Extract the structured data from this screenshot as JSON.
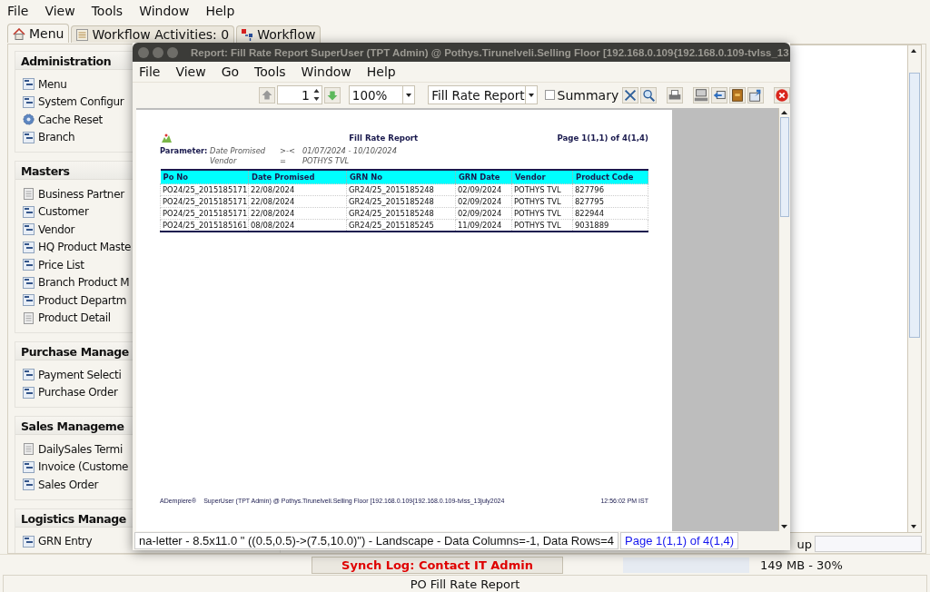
{
  "menubar": [
    "File",
    "View",
    "Tools",
    "Window",
    "Help"
  ],
  "tabs": [
    {
      "label": "Menu",
      "kind": "home",
      "selected": true
    },
    {
      "label": "Workflow Activities: 0",
      "kind": "list",
      "selected": false
    },
    {
      "label": "Workflow",
      "kind": "flow",
      "selected": false
    }
  ],
  "menu_groups": [
    {
      "title": "Administration",
      "items": [
        {
          "label": "Menu",
          "kind": "window"
        },
        {
          "label": "System Configur",
          "kind": "window"
        },
        {
          "label": "Cache Reset",
          "kind": "process"
        },
        {
          "label": "Branch",
          "kind": "window"
        }
      ]
    },
    {
      "title": "Masters",
      "items": [
        {
          "label": "Business Partner",
          "kind": "form"
        },
        {
          "label": "Customer",
          "kind": "window"
        },
        {
          "label": "Vendor",
          "kind": "window"
        },
        {
          "label": "HQ Product Maste",
          "kind": "window"
        },
        {
          "label": "Price List",
          "kind": "window"
        },
        {
          "label": "Branch Product M",
          "kind": "window"
        },
        {
          "label": "Product Departm",
          "kind": "window"
        },
        {
          "label": "Product Detail",
          "kind": "form"
        }
      ]
    },
    {
      "title": "Purchase Manage",
      "items": [
        {
          "label": "Payment Selecti",
          "kind": "window"
        },
        {
          "label": "Purchase Order",
          "kind": "window"
        }
      ]
    },
    {
      "title": "Sales Manageme",
      "items": [
        {
          "label": "DailySales Termi",
          "kind": "form"
        },
        {
          "label": "Invoice (Custome",
          "kind": "window"
        },
        {
          "label": "Sales Order",
          "kind": "window"
        }
      ]
    },
    {
      "title": "Logistics Manage",
      "items": [
        {
          "label": "GRN Entry",
          "kind": "window"
        }
      ]
    }
  ],
  "find_label": "up",
  "status_bar": {
    "sync_log": "Synch Log: Contact IT Admin",
    "memory": "149 MB - 30%"
  },
  "footer_title": "PO Fill Rate Report",
  "report_window": {
    "title": "Report: Fill Rate Report  SuperUser (TPT Admin) @ Pothys.Tirunelveli.Selling Floor [192.168.0.109{192.168.0.109-tvlss_13",
    "menu": [
      "File",
      "View",
      "Go",
      "Tools",
      "Window",
      "Help"
    ],
    "toolbar": {
      "page": "1",
      "zoom": "100%",
      "report": "Fill Rate Report",
      "summary": {
        "label": "Summary",
        "checked": false
      }
    },
    "page": {
      "title": "Fill Rate Report",
      "page_info": "Page 1(1,1) of 4(1,4)",
      "parameter_label": "Parameter:",
      "parameters": [
        {
          "name": "Date Promised",
          "operator": ">-<",
          "value": "01/07/2024 - 10/10/2024"
        },
        {
          "name": "Vendor",
          "operator": "=",
          "value": "POTHYS TVL"
        }
      ],
      "table": {
        "columns": [
          "Po No",
          "Date Promised",
          "GRN No",
          "GRN Date",
          "Vendor",
          "Product Code"
        ],
        "rows": [
          [
            "PO24/25_2015185171",
            "22/08/2024",
            "GR24/25_2015185248",
            "02/09/2024",
            "POTHYS TVL",
            "827796"
          ],
          [
            "PO24/25_2015185171",
            "22/08/2024",
            "GR24/25_2015185248",
            "02/09/2024",
            "POTHYS TVL",
            "827795"
          ],
          [
            "PO24/25_2015185171",
            "22/08/2024",
            "GR24/25_2015185248",
            "02/09/2024",
            "POTHYS TVL",
            "822944"
          ],
          [
            "PO24/25_2015185161",
            "08/08/2024",
            "GR24/25_2015185245",
            "11/09/2024",
            "POTHYS TVL",
            "9031889"
          ]
        ]
      },
      "footer": {
        "brand": "ADempiere®",
        "user": "SuperUser (TPT Admin) @ Pothys.Tirunelveli.Selling Floor [192.168.0.109{192.168.0.109-tvlss_13july2024",
        "time": "12:56:02 PM IST"
      }
    },
    "status": {
      "paper": "na-letter - 8.5x11.0 \" ((0.5,0.5)->(7.5,10.0)\") - Landscape - Data Columns=-1, Data Rows=4",
      "page": "Page 1(1,1) of 4(1,4)"
    }
  }
}
